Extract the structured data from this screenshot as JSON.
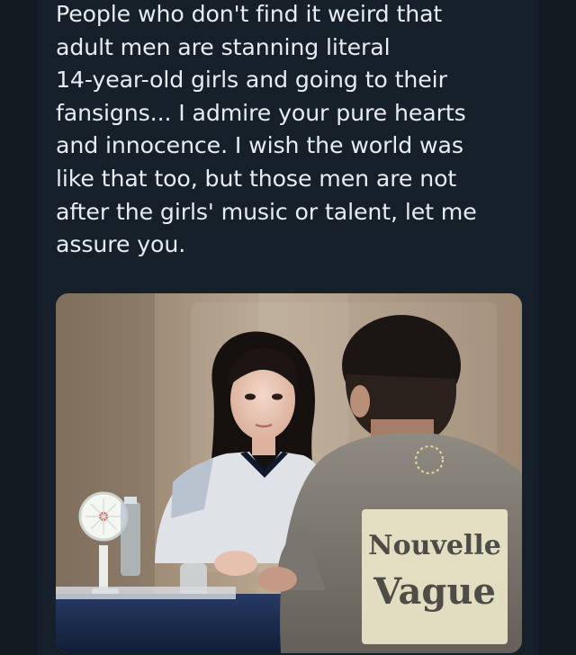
{
  "tweet": {
    "text": "People who don't find it weird that\nadult men are stanning literal\n14-year-old girls and going to their\nfansigns... I admire your pure hearts\nand innocence. I wish the world was\nlike that too, but those men are not\nafter the girls' music or talent, let me\nassure you."
  },
  "media": {
    "shirt_print": [
      "Nouvelle",
      "Vague"
    ]
  },
  "colors": {
    "background": "#15202b",
    "text": "#e7ecf0"
  }
}
